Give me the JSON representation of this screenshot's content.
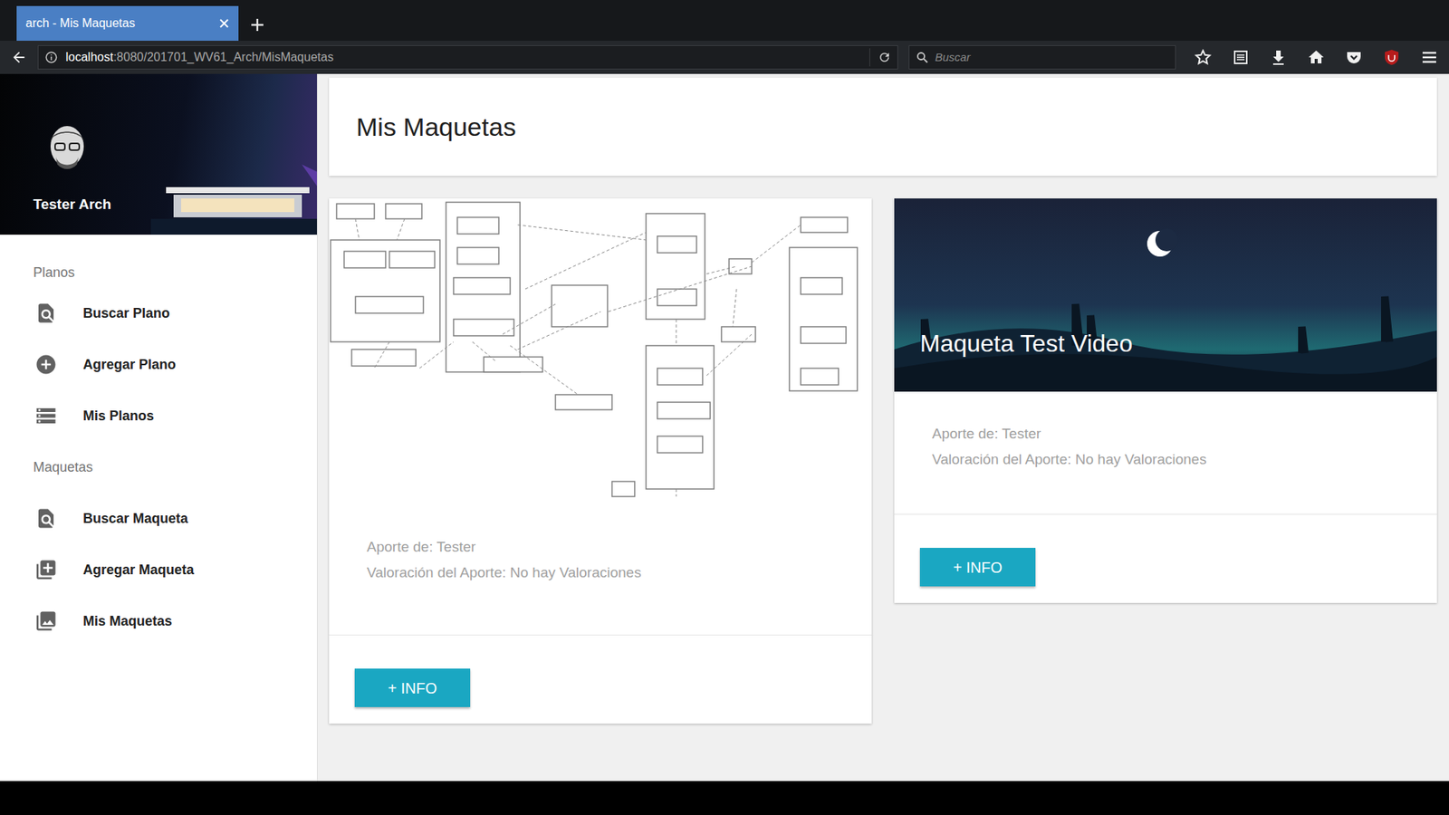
{
  "tabs": [
    {
      "label": "arch - Mis Maquetas",
      "selected": true
    }
  ],
  "address": {
    "host": "localhost",
    "path": ":8080/201701_WV61_Arch/MisMaquetas"
  },
  "search": {
    "placeholder": "Buscar"
  },
  "sidebar": {
    "user": "Tester Arch",
    "sections": [
      {
        "header": "Planos",
        "items": [
          {
            "label": "Buscar Plano"
          },
          {
            "label": "Agregar Plano"
          },
          {
            "label": "Mis Planos"
          }
        ]
      },
      {
        "header": "Maquetas",
        "items": [
          {
            "label": "Buscar Maqueta"
          },
          {
            "label": "Agregar Maqueta"
          },
          {
            "label": "Mis Maquetas"
          }
        ]
      }
    ]
  },
  "page": {
    "title": "Mis Maquetas"
  },
  "cards": [
    {
      "kind": "diagram",
      "author": "Aporte de: Tester",
      "rating": "Valoración del Aporte: No hay Valoraciones",
      "button": "+ INFO"
    },
    {
      "kind": "photo",
      "title": "Maqueta Test Video",
      "author": "Aporte de: Tester",
      "rating": "Valoración del Aporte: No hay Valoraciones",
      "button": "+ INFO"
    }
  ]
}
